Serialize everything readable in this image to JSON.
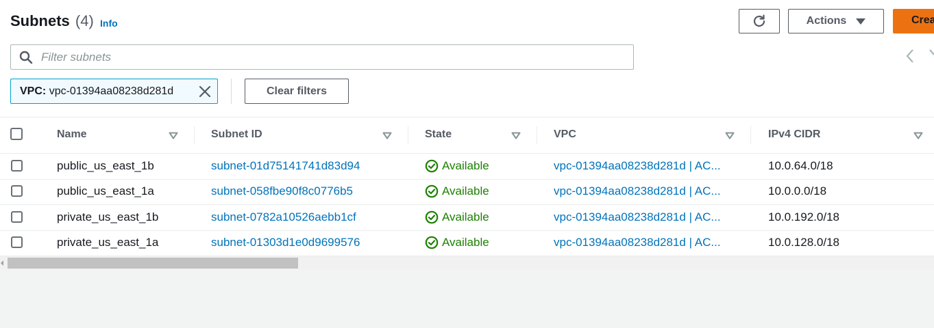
{
  "header": {
    "title": "Subnets",
    "count": "(4)",
    "info_link": "Info",
    "actions_label": "Actions",
    "create_label": "Create subnet"
  },
  "search": {
    "placeholder": "Filter subnets",
    "value": ""
  },
  "filter_token": {
    "key": "VPC:",
    "value": "vpc-01394aa08238d281d"
  },
  "clear_filters_label": "Clear filters",
  "table": {
    "columns": [
      "Name",
      "Subnet ID",
      "State",
      "VPC",
      "IPv4 CIDR"
    ],
    "rows": [
      {
        "name": "public_us_east_1b",
        "subnet_id": "subnet-01d75141741d83d94",
        "state": "Available",
        "vpc": "vpc-01394aa08238d281d | AC...",
        "cidr": "10.0.64.0/18"
      },
      {
        "name": "public_us_east_1a",
        "subnet_id": "subnet-058fbe90f8c0776b5",
        "state": "Available",
        "vpc": "vpc-01394aa08238d281d | AC...",
        "cidr": "10.0.0.0/18"
      },
      {
        "name": "private_us_east_1b",
        "subnet_id": "subnet-0782a10526aebb1cf",
        "state": "Available",
        "vpc": "vpc-01394aa08238d281d | AC...",
        "cidr": "10.0.192.0/18"
      },
      {
        "name": "private_us_east_1a",
        "subnet_id": "subnet-01303d1e0d9699576",
        "state": "Available",
        "vpc": "vpc-01394aa08238d281d | AC...",
        "cidr": "10.0.128.0/18"
      }
    ]
  },
  "colors": {
    "link": "#0073bb",
    "status_available": "#1d8102",
    "primary_button": "#ec7211",
    "filter_token_border": "#00a1c9"
  },
  "icons": {
    "refresh": "refresh-icon",
    "search": "search-icon",
    "close": "close-icon",
    "sort": "sort-down-icon",
    "status": "check-circle-icon",
    "pager_prev": "chevron-left-icon",
    "pager_next": "chevron-right-icon"
  }
}
